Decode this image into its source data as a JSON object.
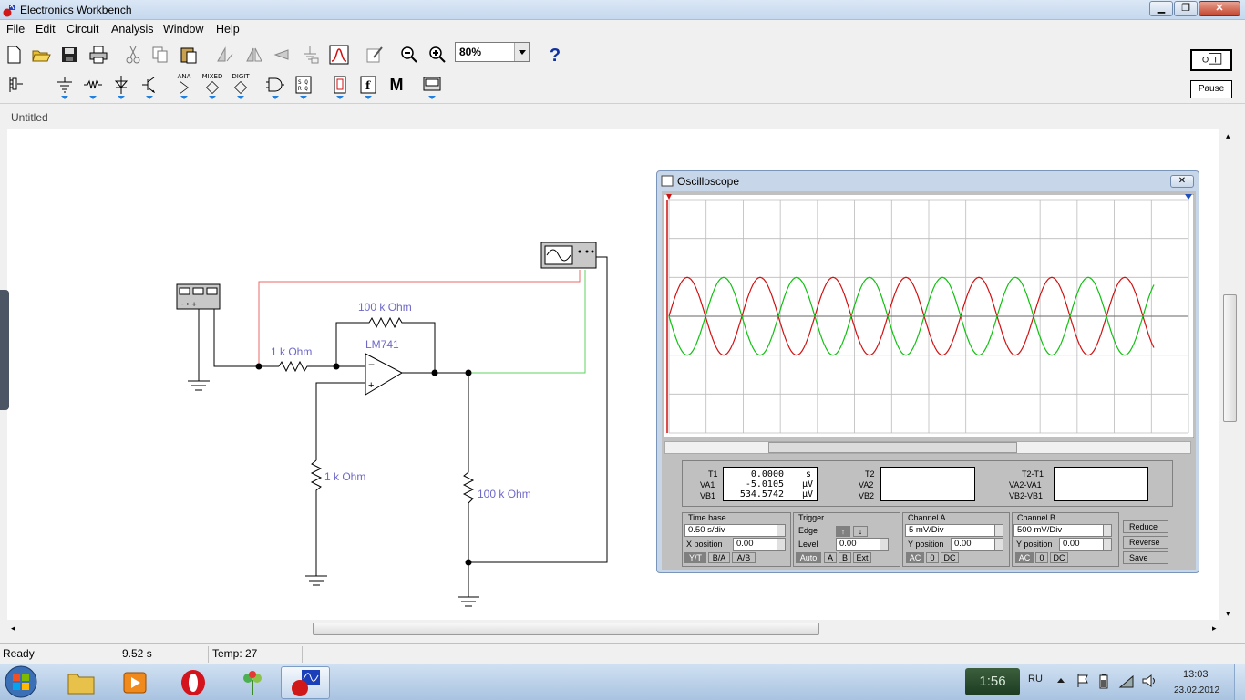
{
  "window": {
    "title": "Electronics Workbench"
  },
  "menu": [
    "File",
    "Edit",
    "Circuit",
    "Analysis",
    "Window",
    "Help"
  ],
  "toolbar": {
    "zoom_value": "80%",
    "help_label": "?",
    "pause_label": "Pause",
    "bin_labels": {
      "analog": "ANA",
      "mixed": "MIXED",
      "digital": "DIGIT",
      "misc": "M"
    }
  },
  "document": {
    "title": "Untitled"
  },
  "circuit": {
    "labels": {
      "r_feedback": "100 k Ohm",
      "r_input": "1 k Ohm",
      "opamp": "LM741",
      "r_ground": "1 k Ohm",
      "r_load": "100 k Ohm"
    }
  },
  "oscilloscope": {
    "title": "Oscilloscope",
    "readouts": {
      "t1_label": "T1",
      "t1_value": "0.0000",
      "t1_unit": "s",
      "va1_label": "VA1",
      "va1_value": "-5.0105",
      "va1_unit": "µV",
      "vb1_label": "VB1",
      "vb1_value": "534.5742",
      "vb1_unit": "µV",
      "t2_label": "T2",
      "va2_label": "VA2",
      "vb2_label": "VB2",
      "t2t1_label": "T2-T1",
      "va2va1_label": "VA2-VA1",
      "vb2vb1_label": "VB2-VB1"
    },
    "timebase": {
      "title": "Time base",
      "value": "0.50 s/div",
      "xpos_label": "X position",
      "xpos_value": "0.00",
      "modes": [
        "Y/T",
        "B/A",
        "A/B"
      ]
    },
    "trigger": {
      "title": "Trigger",
      "edge_label": "Edge",
      "level_label": "Level",
      "level_value": "0.00",
      "buttons": [
        "Auto",
        "A",
        "B",
        "Ext"
      ]
    },
    "channel_a": {
      "title": "Channel A",
      "value": "5 mV/Div",
      "ypos_label": "Y position",
      "ypos_value": "0.00",
      "coupling": [
        "AC",
        "0",
        "DC"
      ]
    },
    "channel_b": {
      "title": "Channel B",
      "value": "500 mV/Div",
      "ypos_label": "Y position",
      "ypos_value": "0.00",
      "coupling": [
        "AC",
        "0",
        "DC"
      ]
    },
    "actions": [
      "Reduce",
      "Reverse",
      "Save"
    ],
    "colors": {
      "channel_a": "#d01010",
      "channel_b": "#10c010",
      "grid": "#888888"
    }
  },
  "status": {
    "state": "Ready",
    "time": "9.52 s",
    "temp": "Temp:  27"
  },
  "taskbar": {
    "gadget_time": "1:56",
    "lang": "RU",
    "clock": "13:03",
    "date": "23.02.2012"
  }
}
